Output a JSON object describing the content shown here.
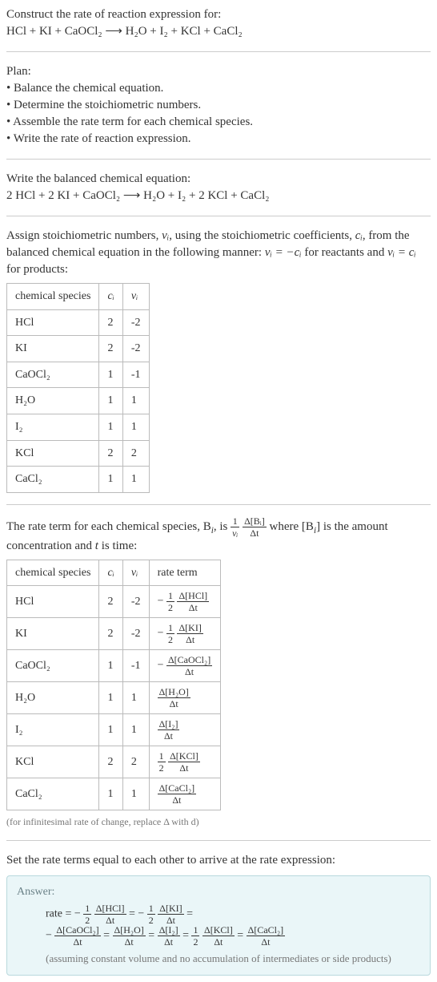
{
  "prompt": {
    "line1": "Construct the rate of reaction expression for:",
    "equation": "HCl + KI + CaOCl₂  ⟶  H₂O + I₂ + KCl + CaCl₂"
  },
  "plan": {
    "heading": "Plan:",
    "b1": "• Balance the chemical equation.",
    "b2": "• Determine the stoichiometric numbers.",
    "b3": "• Assemble the rate term for each chemical species.",
    "b4": "• Write the rate of reaction expression."
  },
  "balanced": {
    "heading": "Write the balanced chemical equation:",
    "equation": "2 HCl + 2 KI + CaOCl₂  ⟶  H₂O + I₂ + 2 KCl + CaCl₂"
  },
  "stoich": {
    "intro_a": "Assign stoichiometric numbers, ",
    "intro_b": ", using the stoichiometric coefficients, ",
    "intro_c": ", from the balanced chemical equation in the following manner: ",
    "intro_d": " for reactants and ",
    "intro_e": " for products:",
    "th1": "chemical species",
    "th2": "cᵢ",
    "th3": "νᵢ",
    "rows": [
      {
        "sp": "HCl",
        "c": "2",
        "v": "-2"
      },
      {
        "sp": "KI",
        "c": "2",
        "v": "-2"
      },
      {
        "sp": "CaOCl₂",
        "c": "1",
        "v": "-1"
      },
      {
        "sp": "H₂O",
        "c": "1",
        "v": "1"
      },
      {
        "sp": "I₂",
        "c": "1",
        "v": "1"
      },
      {
        "sp": "KCl",
        "c": "2",
        "v": "2"
      },
      {
        "sp": "CaCl₂",
        "c": "1",
        "v": "1"
      }
    ]
  },
  "rateterm": {
    "intro_a": "The rate term for each chemical species, B",
    "intro_b": ", is ",
    "intro_c": " where [B",
    "intro_d": "] is the amount concentration and ",
    "intro_e": " is time:",
    "th1": "chemical species",
    "th2": "cᵢ",
    "th3": "νᵢ",
    "th4": "rate term",
    "rows": [
      {
        "sp": "HCl",
        "c": "2",
        "v": "-2",
        "num": "Δ[HCl]",
        "den": "Δt",
        "coef": "− ½"
      },
      {
        "sp": "KI",
        "c": "2",
        "v": "-2",
        "num": "Δ[KI]",
        "den": "Δt",
        "coef": "− ½"
      },
      {
        "sp": "CaOCl₂",
        "c": "1",
        "v": "-1",
        "num": "Δ[CaOCl₂]",
        "den": "Δt",
        "coef": "−"
      },
      {
        "sp": "H₂O",
        "c": "1",
        "v": "1",
        "num": "Δ[H₂O]",
        "den": "Δt",
        "coef": ""
      },
      {
        "sp": "I₂",
        "c": "1",
        "v": "1",
        "num": "Δ[I₂]",
        "den": "Δt",
        "coef": ""
      },
      {
        "sp": "KCl",
        "c": "2",
        "v": "2",
        "num": "Δ[KCl]",
        "den": "Δt",
        "coef": "½"
      },
      {
        "sp": "CaCl₂",
        "c": "1",
        "v": "1",
        "num": "Δ[CaCl₂]",
        "den": "Δt",
        "coef": ""
      }
    ],
    "note": "(for infinitesimal rate of change, replace Δ with d)"
  },
  "final": {
    "heading": "Set the rate terms equal to each other to arrive at the rate expression:",
    "answer_label": "Answer:",
    "line1_pre": "rate = − ",
    "note": "(assuming constant volume and no accumulation of intermediates or side products)"
  },
  "sym": {
    "nu_i": "νᵢ",
    "c_i": "cᵢ",
    "eq_react": "νᵢ = −cᵢ",
    "eq_prod": "νᵢ = cᵢ",
    "i": "i",
    "t": "t",
    "one": "1",
    "dBi": "Δ[Bᵢ]",
    "dt": "Δt",
    "half_num": "1",
    "half_den": "2"
  }
}
